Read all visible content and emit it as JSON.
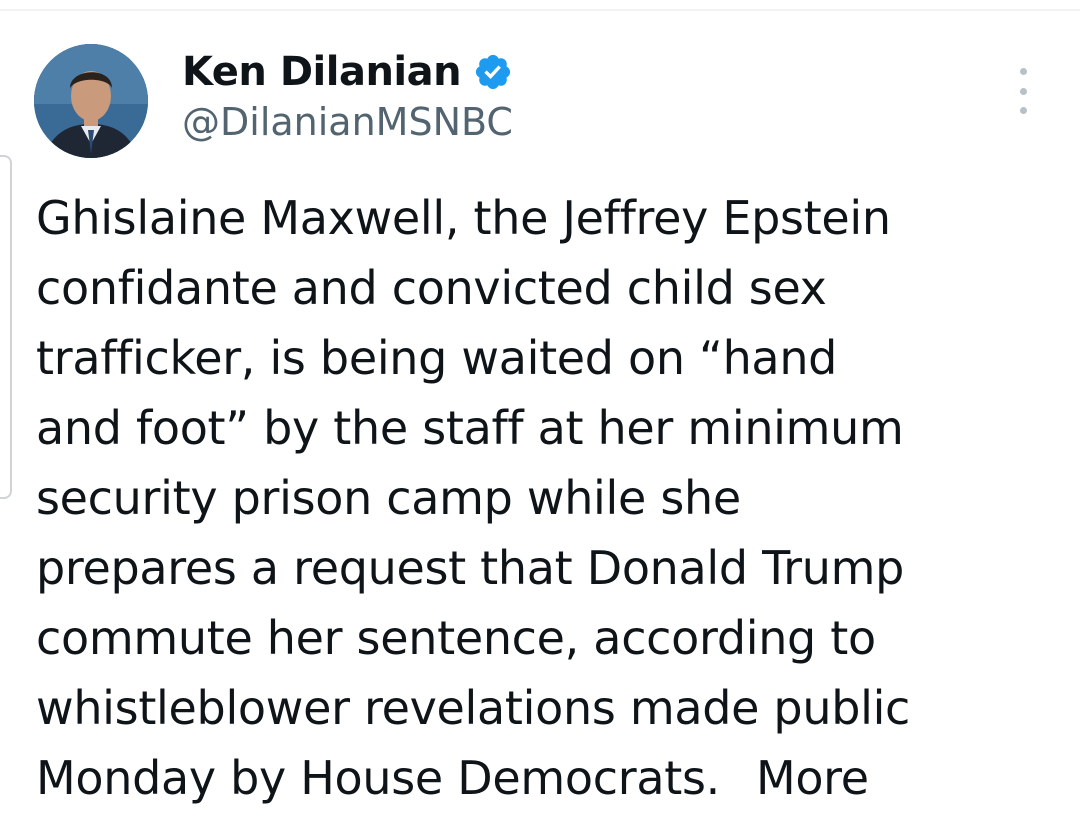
{
  "author": {
    "display_name": "Ken Dilanian",
    "handle": "@DilanianMSNBC",
    "verified": true,
    "verified_color": "#1d9bf0"
  },
  "tweet": {
    "lines": [
      "Ghislaine Maxwell, the Jeffrey Epstein",
      "confidante and convicted child sex",
      "trafficker, is being waited on “hand",
      "and foot” by the staff at her minimum",
      "security prison camp while she",
      "prepares a request that Donald Trump",
      "commute her sentence, according to",
      "whistleblower revelations made public",
      "Monday by House Democrats."
    ],
    "more_label": "More"
  },
  "icons": {
    "verified": "verified-badge-icon",
    "menu": "more-options-icon"
  }
}
